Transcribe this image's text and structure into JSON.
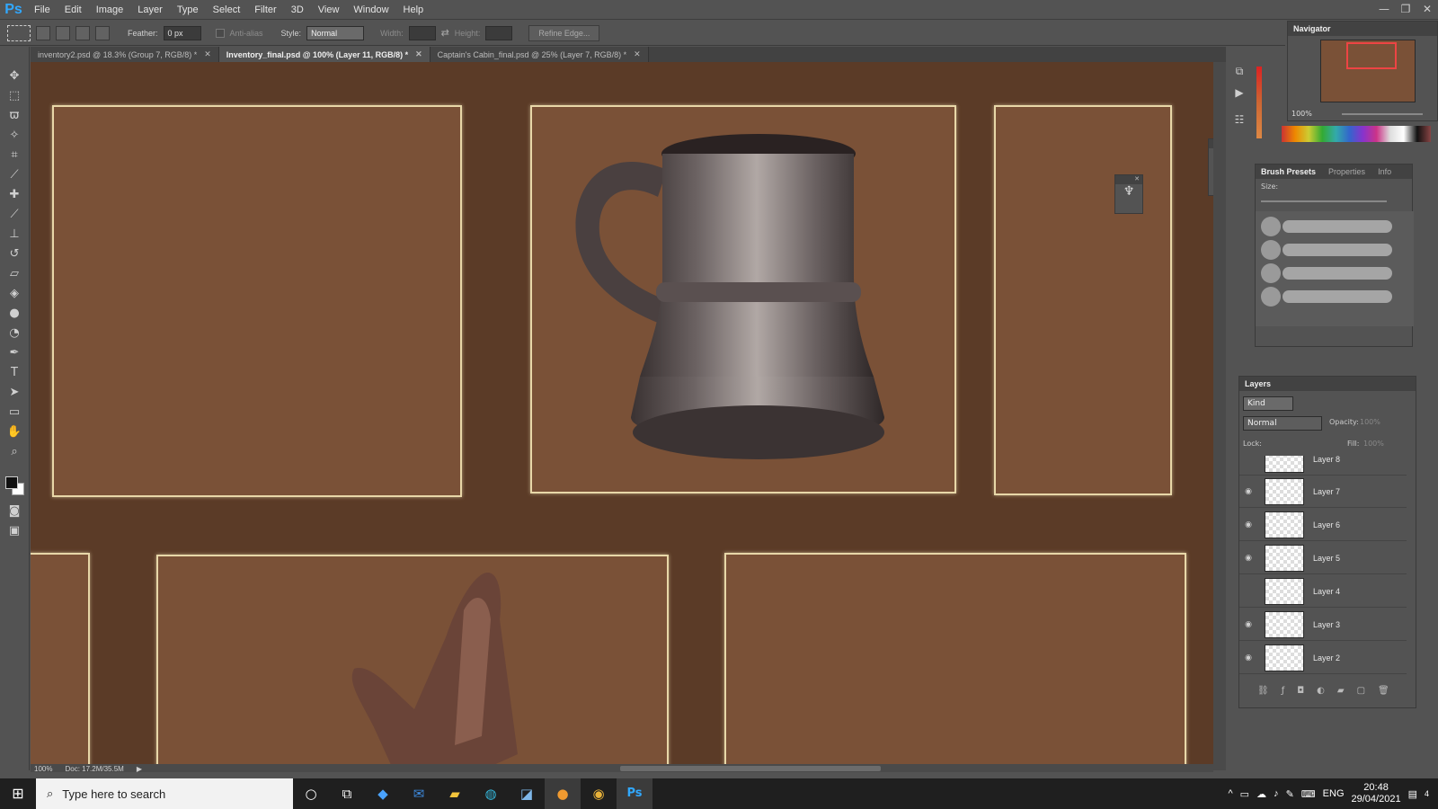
{
  "app": {
    "logo": "Ps",
    "menu": [
      "File",
      "Edit",
      "Image",
      "Layer",
      "Type",
      "Select",
      "Filter",
      "3D",
      "View",
      "Window",
      "Help"
    ],
    "window_controls": [
      "—",
      "❐",
      "✕"
    ]
  },
  "options_bar": {
    "feather_label": "Feather:",
    "feather_value": "0 px",
    "antialias_label": "Anti-alias",
    "style_label": "Style:",
    "style_value": "Normal",
    "width_label": "Width:",
    "height_label": "Height:",
    "refine_edge_label": "Refine Edge..."
  },
  "tabs": [
    {
      "label": "inventory2.psd @ 18.3% (Group 7, RGB/8) *",
      "active": false
    },
    {
      "label": "Inventory_final.psd @ 100% (Layer 11, RGB/8) *",
      "active": true
    },
    {
      "label": "Captain's Cabin_final.psd @ 25% (Layer 7, RGB/8) *",
      "active": false
    }
  ],
  "status": {
    "zoom": "100%",
    "doc_size": "Doc: 17.2M/35.5M"
  },
  "navigator": {
    "title": "Navigator",
    "zoom": "100%"
  },
  "brush_panel": {
    "tabs": [
      "Brush Presets",
      "Properties",
      "Info"
    ],
    "size_label": "Size:"
  },
  "layers_panel": {
    "title": "Layers",
    "filter_kind": "Kind",
    "blend_mode": "Normal",
    "opacity_label": "Opacity:",
    "opacity_value": "100%",
    "lock_label": "Lock:",
    "fill_label": "Fill:",
    "fill_value": "100%",
    "layers": [
      {
        "name": "Layer 8",
        "visible": false
      },
      {
        "name": "Layer 7",
        "visible": true
      },
      {
        "name": "Layer 6",
        "visible": true
      },
      {
        "name": "Layer 5",
        "visible": true
      },
      {
        "name": "Layer 4",
        "visible": false
      },
      {
        "name": "Layer 3",
        "visible": true
      },
      {
        "name": "Layer 2",
        "visible": true
      }
    ]
  },
  "taskbar": {
    "search_placeholder": "Type here to search",
    "language": "ENG",
    "time": "20:48",
    "date": "29/04/2021",
    "notification_count": "4"
  },
  "colors": {
    "canvas_bg": "#5b3b27",
    "slot_bg": "#7a5137",
    "slot_border": "#e8d7a8",
    "ps_blue": "#31a8ff"
  }
}
